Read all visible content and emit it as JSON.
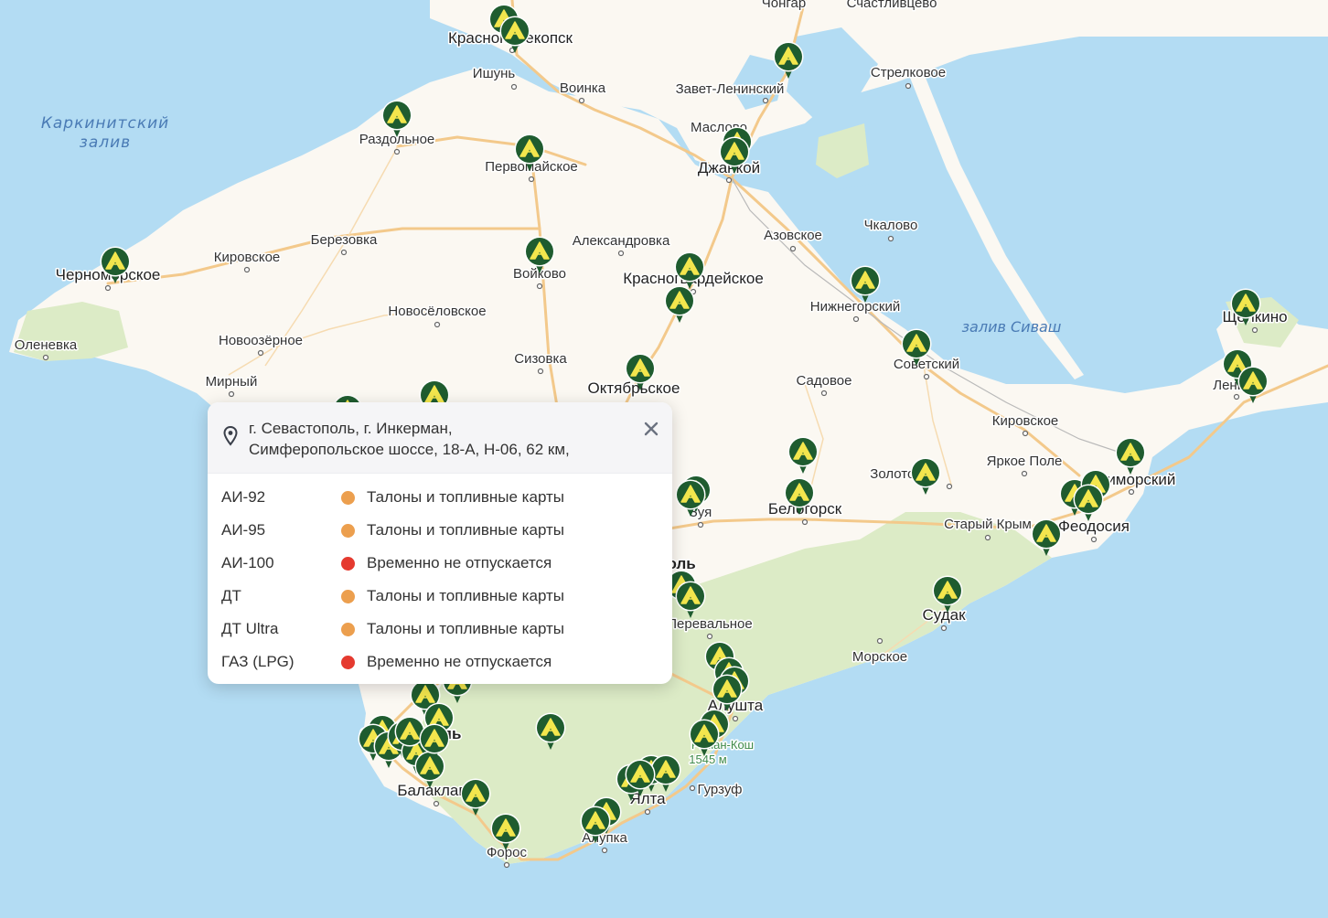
{
  "colors": {
    "sea": "#b3dcf3",
    "land": "#fbf8f2",
    "forest": "#dcebc6",
    "road": "#f3c98b",
    "marker": "#1f5c2f",
    "marker_icon": "#f3e64d",
    "status_orange": "#ec9f4e",
    "status_red": "#e53a2f"
  },
  "map": {
    "water_labels": [
      {
        "id": "karkinit-1",
        "text": "Каркинитский"
      },
      {
        "id": "karkinit-2",
        "text": "залив"
      },
      {
        "id": "sivash",
        "text": "залив Сиваш"
      }
    ],
    "places": [
      {
        "id": "chongar",
        "text": "Чонгар"
      },
      {
        "id": "schastlivtsevo",
        "text": "Счастливцево"
      },
      {
        "id": "krasnoperekopsk",
        "text": "Красноперекопск"
      },
      {
        "id": "ishun",
        "text": "Ишунь"
      },
      {
        "id": "voinka",
        "text": "Воинка"
      },
      {
        "id": "zavet-leninsky",
        "text": "Завет-Ленинский"
      },
      {
        "id": "strelkovoe",
        "text": "Стрелковое"
      },
      {
        "id": "razdolnoe",
        "text": "Раздольное"
      },
      {
        "id": "pervomayskoe",
        "text": "Первомайское"
      },
      {
        "id": "maslovo",
        "text": "Маслово"
      },
      {
        "id": "dzhankoy",
        "text": "Джанкой"
      },
      {
        "id": "berezovka",
        "text": "Березовка"
      },
      {
        "id": "kirovskoe-w",
        "text": "Кировское"
      },
      {
        "id": "aleksandrovka",
        "text": "Александровка"
      },
      {
        "id": "azovskoe",
        "text": "Азовское"
      },
      {
        "id": "chkalovo",
        "text": "Чкалово"
      },
      {
        "id": "chernomorskoe",
        "text": "Черноморское"
      },
      {
        "id": "voykovo",
        "text": "Войково"
      },
      {
        "id": "krasnogvardeyskoe",
        "text": "Красногвардейское"
      },
      {
        "id": "nizhnegorsky",
        "text": "Нижнегорский"
      },
      {
        "id": "schelkino",
        "text": "Щёлкино"
      },
      {
        "id": "novoselovskoe",
        "text": "Новосёловское"
      },
      {
        "id": "olenevka",
        "text": "Оленевка"
      },
      {
        "id": "novoozernoe",
        "text": "Новоозёрное"
      },
      {
        "id": "sovetsky",
        "text": "Советский"
      },
      {
        "id": "sizovka",
        "text": "Сизовка"
      },
      {
        "id": "mirny",
        "text": "Мирный"
      },
      {
        "id": "oktyabrskoe",
        "text": "Октябрьское"
      },
      {
        "id": "sadovoe",
        "text": "Садовое"
      },
      {
        "id": "lenino",
        "text": "Ленино"
      },
      {
        "id": "kirovskoe-e",
        "text": "Кировское"
      },
      {
        "id": "yarkoe-pole",
        "text": "Яркое Поле"
      },
      {
        "id": "zolotoe",
        "text": "Золотое"
      },
      {
        "id": "primorsky",
        "text": "Приморский"
      },
      {
        "id": "zuya",
        "text": "Зуя"
      },
      {
        "id": "belogorsk",
        "text": "Белогорск"
      },
      {
        "id": "stary-krym",
        "text": "Старый Крым"
      },
      {
        "id": "feodosiya",
        "text": "Феодосия"
      },
      {
        "id": "simferopol",
        "text": "Симферополь"
      },
      {
        "id": "perevalnoe",
        "text": "Перевальное"
      },
      {
        "id": "sudak",
        "text": "Судак"
      },
      {
        "id": "morskoe",
        "text": "Морское"
      },
      {
        "id": "alushta",
        "text": "Алушта"
      },
      {
        "id": "sevastopol",
        "text": "Севастополь"
      },
      {
        "id": "roman-kosh",
        "text": "Роман-Кош"
      },
      {
        "id": "roman-kosh-h",
        "text": "1545 м"
      },
      {
        "id": "balaklava",
        "text": "Балаклава"
      },
      {
        "id": "yalta",
        "text": "Ялта"
      },
      {
        "id": "gurzuf",
        "text": "Гурзуф"
      },
      {
        "id": "alupka",
        "text": "Алупка"
      },
      {
        "id": "foros",
        "text": "Форос"
      }
    ]
  },
  "popup": {
    "address_line1": "г. Севастополь, г. Инкерман,",
    "address_line2": "Симферопольское шоссе, 18-А, Н-06, 62 км,",
    "fuels": [
      {
        "name": "АИ-92",
        "status": "Талоны и топливные карты",
        "color": "#ec9f4e"
      },
      {
        "name": "АИ-95",
        "status": "Талоны и топливные карты",
        "color": "#ec9f4e"
      },
      {
        "name": "АИ-100",
        "status": "Временно не отпускается",
        "color": "#e53a2f"
      },
      {
        "name": "ДТ",
        "status": "Талоны и топливные карты",
        "color": "#ec9f4e"
      },
      {
        "name": "ДТ Ultra",
        "status": "Талоны и топливные карты",
        "color": "#ec9f4e"
      },
      {
        "name": "ГАЗ (LPG)",
        "status": "Временно не отпускается",
        "color": "#e53a2f"
      }
    ]
  }
}
